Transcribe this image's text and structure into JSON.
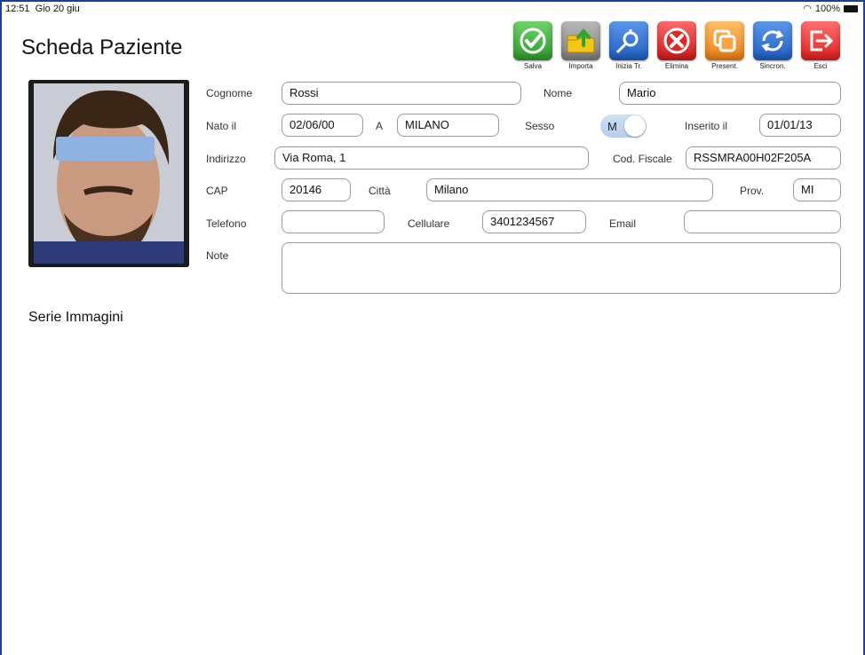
{
  "status": {
    "time": "12:51",
    "date": "Gio 20 giu",
    "battery": "100%"
  },
  "title": "Scheda Paziente",
  "toolbar": [
    {
      "label": "Salva",
      "icon": "check-icon",
      "color": "#3aa836"
    },
    {
      "label": "Importa",
      "icon": "folder-import-icon",
      "color": "#8c8c8c"
    },
    {
      "label": "Inizia Tr.",
      "icon": "start-treatment-icon",
      "color": "#2a6fd0"
    },
    {
      "label": "Elimina",
      "icon": "delete-icon",
      "color": "#e02525"
    },
    {
      "label": "Present.",
      "icon": "presentation-icon",
      "color": "#f08c1c"
    },
    {
      "label": "Sincron.",
      "icon": "sync-icon",
      "color": "#2a6fd0"
    },
    {
      "label": "Esci",
      "icon": "exit-icon",
      "color": "#e52a2a"
    }
  ],
  "form": {
    "cognome": {
      "label": "Cognome",
      "value": "Rossi"
    },
    "nome": {
      "label": "Nome",
      "value": "Mario"
    },
    "nato_il": {
      "label": "Nato il",
      "value": "02/06/00"
    },
    "a": {
      "label": "A",
      "value": "MILANO"
    },
    "sesso": {
      "label": "Sesso",
      "value": "M"
    },
    "inserito_il": {
      "label": "Inserito il",
      "value": "01/01/13"
    },
    "indirizzo": {
      "label": "Indirizzo",
      "value": "Via Roma, 1"
    },
    "cod_fiscale": {
      "label": "Cod. Fiscale",
      "value": "RSSMRA00H02F205A"
    },
    "cap": {
      "label": "CAP",
      "value": "20146"
    },
    "citta": {
      "label": "Città",
      "value": "Milano"
    },
    "prov": {
      "label": "Prov.",
      "value": "MI"
    },
    "telefono": {
      "label": "Telefono",
      "value": ""
    },
    "cellulare": {
      "label": "Cellulare",
      "value": "3401234567"
    },
    "email": {
      "label": "Email",
      "value": ""
    },
    "note": {
      "label": "Note",
      "value": ""
    }
  },
  "serie_immagini": "Serie Immagini"
}
